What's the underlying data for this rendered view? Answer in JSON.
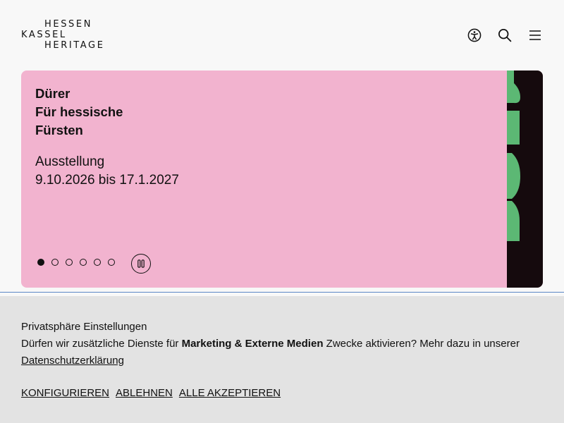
{
  "logo": {
    "line1": "HESSEN",
    "line2": "KASSEL",
    "line3": "HERITAGE"
  },
  "header": {
    "icons": [
      "accessibility-icon",
      "search-icon",
      "menu-icon"
    ]
  },
  "hero": {
    "title_lines": [
      "Dürer",
      "Für hessische",
      "Fürsten"
    ],
    "type": "Ausstellung",
    "dates": "9.10.2026 bis 17.1.2027",
    "slide_count": 6,
    "active_slide": 1,
    "background_color": "#f2b3cf",
    "accent_color": "#5cb874",
    "dark_color": "#150a0d"
  },
  "cookie": {
    "title": "Privatsphäre Einstellungen",
    "text_before": "Dürfen wir zusätzliche Dienste für ",
    "text_bold": "Marketing & Externe Medien",
    "text_after": " Zwecke aktivieren? Mehr dazu in unserer ",
    "link": "Datenschutzerklärung",
    "actions": [
      "KONFIGURIEREN",
      "ABLEHNEN",
      "ALLE AKZEPTIEREN"
    ]
  }
}
